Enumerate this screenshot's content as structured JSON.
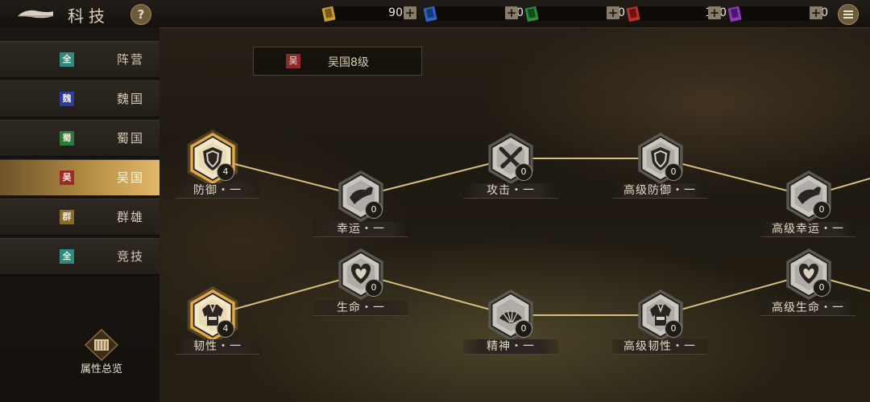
{
  "header": {
    "title": "科技",
    "help_label": "?"
  },
  "resources": [
    {
      "name": "gold-book-icon",
      "color": "#c99a36",
      "value": "90"
    },
    {
      "name": "blue-book-icon",
      "color": "#2f63c8",
      "value": "0"
    },
    {
      "name": "green-book-icon",
      "color": "#2c8a3c",
      "value": "0"
    },
    {
      "name": "red-book-icon",
      "color": "#b8322c",
      "value": "170"
    },
    {
      "name": "purple-book-icon",
      "color": "#8a3cb8",
      "value": "0"
    }
  ],
  "plus_label": "+",
  "sidebar": {
    "items": [
      {
        "tag": "全",
        "tag_color": "#2e8a80",
        "label": "阵营",
        "active": false
      },
      {
        "tag": "魏",
        "tag_color": "#2c3c9c",
        "label": "魏国",
        "active": false
      },
      {
        "tag": "蜀",
        "tag_color": "#2c7a3a",
        "label": "蜀国",
        "active": false
      },
      {
        "tag": "吴",
        "tag_color": "#9c2c2c",
        "label": "吴国",
        "active": true
      },
      {
        "tag": "群",
        "tag_color": "#8a6a2c",
        "label": "群雄",
        "active": false
      },
      {
        "tag": "全",
        "tag_color": "#2e8a80",
        "label": "竞技",
        "active": false
      }
    ],
    "attr_overview": "属性总览"
  },
  "level": {
    "tag": "吴",
    "text": "吴国8级"
  },
  "tree": {
    "nodes": [
      {
        "id": "defense-1",
        "label": "防御・一",
        "level": "4",
        "unlocked": true,
        "icon": "shield-icon"
      },
      {
        "id": "luck-1",
        "label": "幸运・一",
        "level": "0",
        "unlocked": false,
        "icon": "horn-icon"
      },
      {
        "id": "attack-1",
        "label": "攻击・一",
        "level": "0",
        "unlocked": false,
        "icon": "crossed-swords-icon"
      },
      {
        "id": "adv-defense-1",
        "label": "高级防御・一",
        "level": "0",
        "unlocked": false,
        "icon": "shield-icon"
      },
      {
        "id": "adv-luck-1",
        "label": "高级幸运・一",
        "level": "0",
        "unlocked": false,
        "icon": "horn-icon"
      },
      {
        "id": "toughness-1",
        "label": "韧性・一",
        "level": "4",
        "unlocked": true,
        "icon": "armor-icon"
      },
      {
        "id": "life-1",
        "label": "生命・一",
        "level": "0",
        "unlocked": false,
        "icon": "heart-icon"
      },
      {
        "id": "spirit-1",
        "label": "精神・一",
        "level": "0",
        "unlocked": false,
        "icon": "fan-icon"
      },
      {
        "id": "adv-toughness-1",
        "label": "高级韧性・一",
        "level": "0",
        "unlocked": false,
        "icon": "armor-icon"
      },
      {
        "id": "adv-life-1",
        "label": "高级生命・一",
        "level": "0",
        "unlocked": false,
        "icon": "heart-icon"
      }
    ]
  }
}
